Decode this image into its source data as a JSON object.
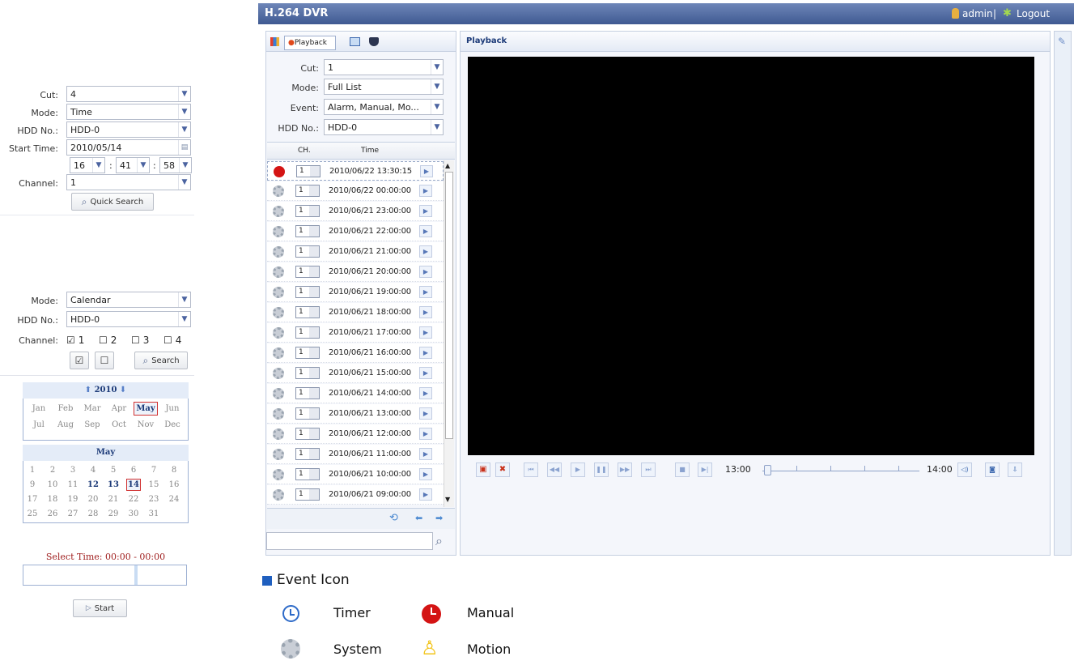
{
  "quick_search": {
    "cut_label": "Cut:",
    "cut_value": "4",
    "mode_label": "Mode:",
    "mode_value": "Time",
    "hdd_label": "HDD No.:",
    "hdd_value": "HDD-0",
    "start_time_label": "Start Time:",
    "start_date": "2010/05/14",
    "hour": "16",
    "minute": "41",
    "second": "58",
    "sep": ":",
    "channel_label": "Channel:",
    "channel_value": "1",
    "button": "Quick Search"
  },
  "calendar_search": {
    "mode_label": "Mode:",
    "mode_value": "Calendar",
    "hdd_label": "HDD No.:",
    "hdd_value": "HDD-0",
    "channel_label": "Channel:",
    "channels": [
      {
        "label": "1",
        "checked": true
      },
      {
        "label": "2",
        "checked": false
      },
      {
        "label": "3",
        "checked": false
      },
      {
        "label": "4",
        "checked": false
      }
    ],
    "search_button": "Search",
    "year": "2010",
    "months_row1": [
      "Jan",
      "Feb",
      "Mar",
      "Apr",
      "May",
      "Jun"
    ],
    "months_row2": [
      "Jul",
      "Aug",
      "Sep",
      "Oct",
      "Nov",
      "Dec"
    ],
    "selected_month": "May",
    "month_title": "May",
    "days": [
      "1",
      "2",
      "3",
      "4",
      "5",
      "6",
      "7",
      "8",
      "9",
      "10",
      "11",
      "12",
      "13",
      "14",
      "15",
      "16",
      "17",
      "18",
      "19",
      "20",
      "21",
      "22",
      "23",
      "24",
      "25",
      "26",
      "27",
      "28",
      "29",
      "30",
      "31"
    ],
    "bold_days": [
      "12",
      "13",
      "14"
    ],
    "selected_day": "14",
    "select_time": "Select Time: 00:00 - 00:00",
    "start_button": "Start"
  },
  "app": {
    "title": "H.264 DVR",
    "user": "admin",
    "separator": "|",
    "logout": "Logout"
  },
  "left_panel": {
    "tab_playback": "Playback",
    "cut_label": "Cut:",
    "cut_value": "1",
    "mode_label": "Mode:",
    "mode_value": "Full List",
    "event_label": "Event:",
    "event_value": "Alarm, Manual, Mo...",
    "hdd_label": "HDD No.:",
    "hdd_value": "HDD-0",
    "col_ch": "CH.",
    "col_time": "Time",
    "rows": [
      {
        "type": "manual",
        "ch": "1",
        "time": "2010/06/22 13:30:15"
      },
      {
        "type": "system",
        "ch": "1",
        "time": "2010/06/22 00:00:00"
      },
      {
        "type": "system",
        "ch": "1",
        "time": "2010/06/21 23:00:00"
      },
      {
        "type": "system",
        "ch": "1",
        "time": "2010/06/21 22:00:00"
      },
      {
        "type": "system",
        "ch": "1",
        "time": "2010/06/21 21:00:00"
      },
      {
        "type": "system",
        "ch": "1",
        "time": "2010/06/21 20:00:00"
      },
      {
        "type": "system",
        "ch": "1",
        "time": "2010/06/21 19:00:00"
      },
      {
        "type": "system",
        "ch": "1",
        "time": "2010/06/21 18:00:00"
      },
      {
        "type": "system",
        "ch": "1",
        "time": "2010/06/21 17:00:00"
      },
      {
        "type": "system",
        "ch": "1",
        "time": "2010/06/21 16:00:00"
      },
      {
        "type": "system",
        "ch": "1",
        "time": "2010/06/21 15:00:00"
      },
      {
        "type": "system",
        "ch": "1",
        "time": "2010/06/21 14:00:00"
      },
      {
        "type": "system",
        "ch": "1",
        "time": "2010/06/21 13:00:00"
      },
      {
        "type": "system",
        "ch": "1",
        "time": "2010/06/21 12:00:00"
      },
      {
        "type": "system",
        "ch": "1",
        "time": "2010/06/21 11:00:00"
      },
      {
        "type": "system",
        "ch": "1",
        "time": "2010/06/21 10:00:00"
      },
      {
        "type": "system",
        "ch": "1",
        "time": "2010/06/21 09:00:00"
      }
    ],
    "search_placeholder": ""
  },
  "playback": {
    "title": "Playback",
    "timeline_start": "13:00",
    "timeline_end": "14:00"
  },
  "legend": {
    "title": "Event Icon",
    "timer": "Timer",
    "manual": "Manual",
    "system": "System",
    "motion": "Motion"
  },
  "colors": {
    "header_bg": "#4a6399",
    "video_bg": "#000000",
    "manual_icon": "#d41414",
    "accent_blue": "#1f5fbf"
  }
}
